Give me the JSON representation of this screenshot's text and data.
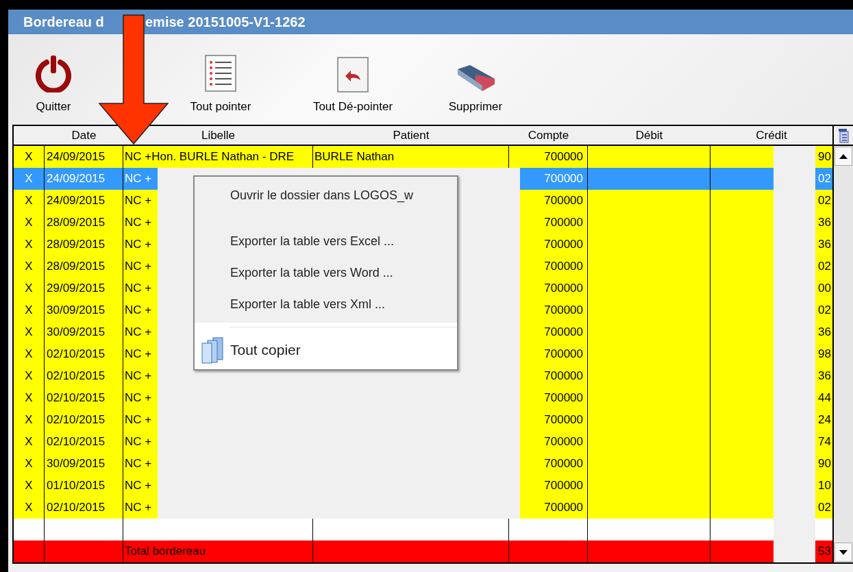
{
  "window": {
    "title_parts": [
      "Bordereau d",
      "emise 20151005-V1-1262"
    ]
  },
  "toolbar": [
    {
      "kind": "power",
      "label": "Quitter"
    },
    {
      "kind": "list",
      "label": "Tout pointer"
    },
    {
      "kind": "undo",
      "label": "Tout Dé-pointer"
    },
    {
      "kind": "eraser",
      "label": "Supprimer"
    }
  ],
  "table": {
    "columns": [
      "",
      "Date",
      "Libelle",
      "Patient",
      "Compte",
      "Débit",
      "Crédit"
    ],
    "rows": [
      {
        "pointed": "X",
        "date": "24/09/2015",
        "libelle": "NC +Hon. BURLE Nathan - DRE",
        "patient": "BURLE Nathan",
        "compte": "700000",
        "credit": "90",
        "selected": false
      },
      {
        "pointed": "X",
        "date": "24/09/2015",
        "libelle": "NC +",
        "compte": "700000",
        "credit": "02",
        "selected": true
      },
      {
        "pointed": "X",
        "date": "24/09/2015",
        "libelle": "NC +",
        "compte": "700000",
        "credit": "02",
        "selected": false
      },
      {
        "pointed": "X",
        "date": "28/09/2015",
        "libelle": "NC +",
        "compte": "700000",
        "credit": "36",
        "selected": false
      },
      {
        "pointed": "X",
        "date": "28/09/2015",
        "libelle": "NC +",
        "compte": "700000",
        "credit": "36",
        "selected": false
      },
      {
        "pointed": "X",
        "date": "28/09/2015",
        "libelle": "NC +",
        "compte": "700000",
        "credit": "02",
        "selected": false
      },
      {
        "pointed": "X",
        "date": "29/09/2015",
        "libelle": "NC +",
        "compte": "700000",
        "credit": "00",
        "selected": false
      },
      {
        "pointed": "X",
        "date": "30/09/2015",
        "libelle": "NC +",
        "compte": "700000",
        "credit": "02",
        "selected": false
      },
      {
        "pointed": "X",
        "date": "30/09/2015",
        "libelle": "NC +",
        "compte": "700000",
        "credit": "36",
        "selected": false
      },
      {
        "pointed": "X",
        "date": "02/10/2015",
        "libelle": "NC +",
        "compte": "700000",
        "credit": "98",
        "selected": false
      },
      {
        "pointed": "X",
        "date": "02/10/2015",
        "libelle": "NC +",
        "compte": "700000",
        "credit": "36",
        "selected": false
      },
      {
        "pointed": "X",
        "date": "02/10/2015",
        "libelle": "NC +",
        "compte": "700000",
        "credit": "44",
        "selected": false
      },
      {
        "pointed": "X",
        "date": "02/10/2015",
        "libelle": "NC +",
        "compte": "700000",
        "credit": "24",
        "selected": false
      },
      {
        "pointed": "X",
        "date": "02/10/2015",
        "libelle": "NC +",
        "compte": "700000",
        "credit": "74",
        "selected": false
      },
      {
        "pointed": "X",
        "date": "30/09/2015",
        "libelle": "NC +",
        "compte": "700000",
        "credit": "90",
        "selected": false
      },
      {
        "pointed": "X",
        "date": "01/10/2015",
        "libelle": "NC +",
        "compte": "700000",
        "credit": "10",
        "selected": false
      },
      {
        "pointed": "X",
        "date": "02/10/2015",
        "libelle": "NC +",
        "compte": "700000",
        "credit": "02",
        "selected": false
      }
    ],
    "total": {
      "label": "Total bordereau",
      "credit": "53"
    }
  },
  "context_menu": [
    {
      "kind": "item",
      "label": "Ouvrir le dossier dans LOGOS_w",
      "highlighted": false
    },
    {
      "kind": "gap"
    },
    {
      "kind": "item",
      "label": "Exporter la table vers Excel ...",
      "highlighted": false
    },
    {
      "kind": "item",
      "label": "Exporter la table vers Word ...",
      "highlighted": false
    },
    {
      "kind": "item",
      "label": "Exporter la table vers Xml ...",
      "highlighted": false
    },
    {
      "kind": "separator"
    },
    {
      "kind": "icon-item",
      "label": "Tout copier",
      "highlighted": true
    }
  ]
}
